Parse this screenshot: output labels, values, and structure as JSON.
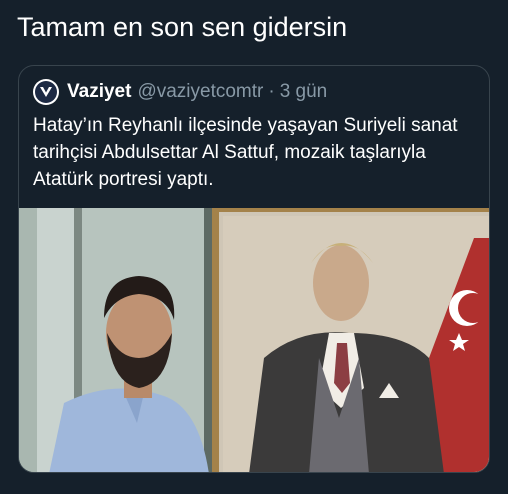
{
  "tweet": {
    "text": "Tamam en son sen gidersin"
  },
  "quoted_tweet": {
    "display_name": "Vaziyet",
    "handle": "@vaziyetcomtr",
    "separator": "·",
    "time": "3 gün",
    "body": "Hatay’ın Reyhanlı ilçesinde yaşayan Suriyeli sanat tarihçisi Abdulsettar Al Sattuf, mozaik taşlarıyla Atatürk portresi yaptı.",
    "avatar_icon": "vaziyet-logo-icon"
  },
  "colors": {
    "background": "#15202b",
    "border": "#38444d",
    "secondary_text": "#8899a6"
  }
}
